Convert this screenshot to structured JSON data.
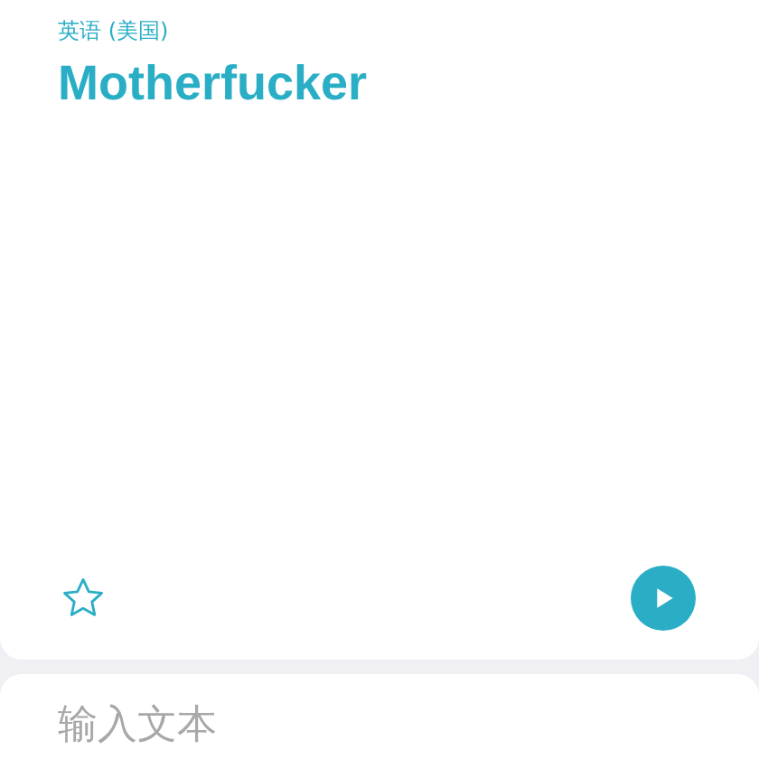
{
  "result": {
    "language": "英语 (美国)",
    "text": "Motherfucker",
    "favorited": false
  },
  "input": {
    "placeholder": "输入文本"
  }
}
